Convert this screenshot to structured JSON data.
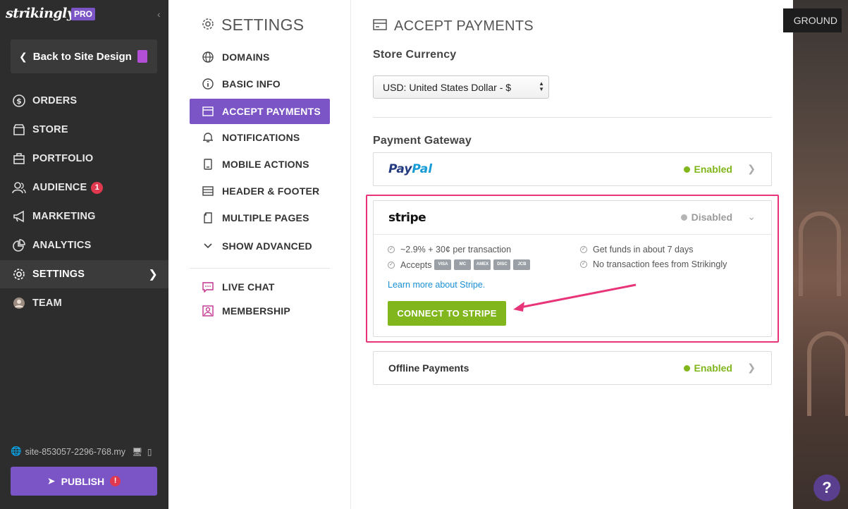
{
  "app": {
    "logo": "strikingly",
    "plan_badge": "PRO",
    "collapse_glyph": "‹"
  },
  "sidebar": {
    "back_label": "Back to Site Design",
    "items": [
      {
        "label": "ORDERS",
        "icon": "dollar-circle-icon"
      },
      {
        "label": "STORE",
        "icon": "store-icon"
      },
      {
        "label": "PORTFOLIO",
        "icon": "briefcase-icon"
      },
      {
        "label": "AUDIENCE",
        "icon": "users-icon",
        "badge": "1"
      },
      {
        "label": "MARKETING",
        "icon": "megaphone-icon"
      },
      {
        "label": "ANALYTICS",
        "icon": "pie-chart-icon"
      },
      {
        "label": "SETTINGS",
        "icon": "gear-icon",
        "active": true
      },
      {
        "label": "TEAM",
        "icon": "team-avatar-icon"
      }
    ],
    "site_url": "site-853057-2296-768.my",
    "publish_label": "PUBLISH",
    "publish_alert": "!"
  },
  "settings_nav": {
    "title": "SETTINGS",
    "items": [
      {
        "label": "DOMAINS",
        "icon": "globe-icon"
      },
      {
        "label": "BASIC INFO",
        "icon": "info-icon"
      },
      {
        "label": "ACCEPT PAYMENTS",
        "icon": "card-icon",
        "active": true
      },
      {
        "label": "NOTIFICATIONS",
        "icon": "bell-icon"
      },
      {
        "label": "MOBILE ACTIONS",
        "icon": "mobile-icon"
      },
      {
        "label": "HEADER & FOOTER",
        "icon": "layout-icon"
      },
      {
        "label": "MULTIPLE PAGES",
        "icon": "pages-icon"
      },
      {
        "label": "SHOW ADVANCED",
        "icon": "chevron-down-icon"
      }
    ],
    "extras": [
      {
        "label": "LIVE CHAT",
        "icon": "chat-icon"
      },
      {
        "label": "MEMBERSHIP",
        "icon": "member-icon"
      }
    ]
  },
  "content": {
    "title": "ACCEPT PAYMENTS",
    "currency_label": "Store Currency",
    "currency_value": "USD: United States Dollar - $",
    "gateway_label": "Payment Gateway",
    "gateways": {
      "paypal": {
        "name": "PayPal",
        "status": "Enabled"
      },
      "stripe": {
        "name": "stripe",
        "status": "Disabled",
        "features": [
          "~2.9% + 30¢ per transaction",
          "Accepts",
          "Get funds in about 7 days",
          "No transaction fees from Strikingly"
        ],
        "cards": [
          "VISA",
          "MC",
          "AMEX",
          "DISC",
          "JCB"
        ],
        "learn_more": "Learn more about Stripe.",
        "connect_label": "CONNECT TO STRIPE"
      },
      "offline": {
        "name": "Offline Payments",
        "status": "Enabled"
      }
    }
  },
  "preview": {
    "button_label": "GROUND",
    "help_label": "?"
  },
  "colors": {
    "purple": "#7b54c6",
    "green": "#81b61c",
    "highlight": "#e8357a",
    "enabled": "#81b61c",
    "disabled": "#9b9b9b"
  }
}
